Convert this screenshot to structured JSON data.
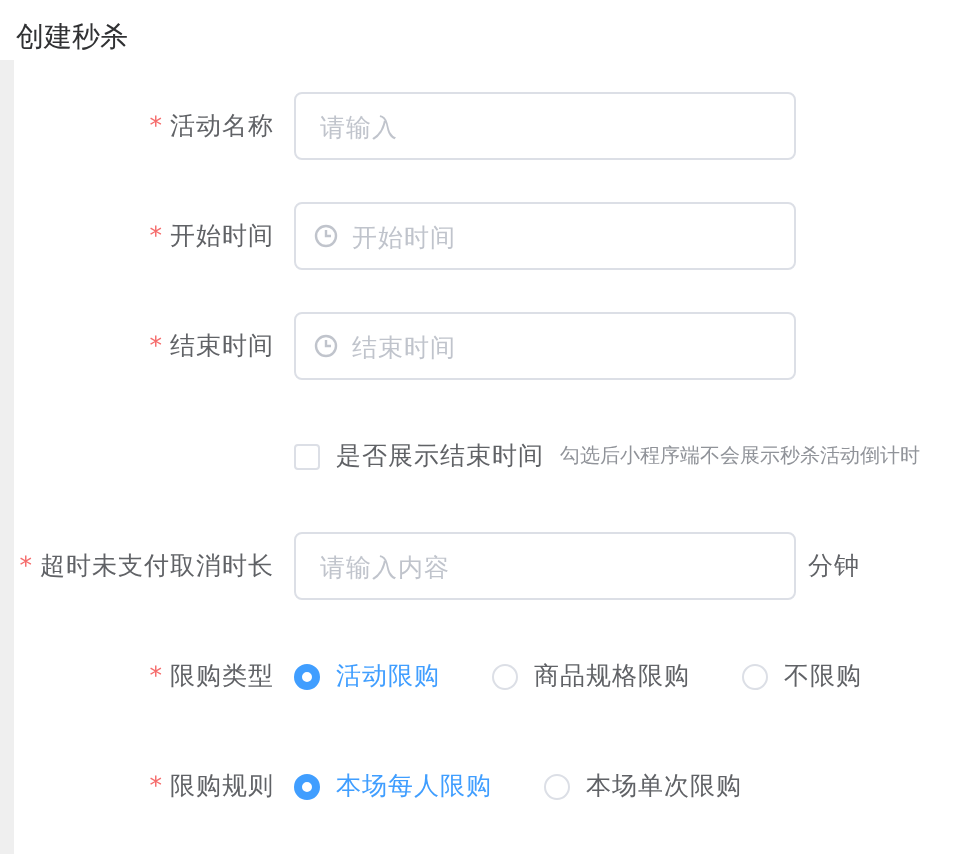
{
  "page_title": "创建秒杀",
  "form": [
    {
      "kind": "text",
      "label": "活动名称",
      "mark": "*",
      "placeholder": "请输入"
    },
    {
      "kind": "time",
      "label": "开始时间",
      "mark": "*",
      "placeholder": "开始时间"
    },
    {
      "kind": "time",
      "label": "结束时间",
      "mark": "*",
      "placeholder": "结束时间"
    },
    {
      "kind": "checkbox",
      "text": "是否展示结束时间",
      "checked": false,
      "hint": "勾选后小程序端不会展示秒杀活动倒计时"
    },
    {
      "kind": "text",
      "label": "超时未支付取消时长",
      "mark": "*",
      "placeholder": "请输入内容",
      "suffix": "分钟"
    },
    {
      "kind": "radio",
      "label": "限购类型",
      "mark": "*",
      "options": [
        {
          "label": "活动限购",
          "selected": true
        },
        {
          "label": "商品规格限购",
          "selected": false
        },
        {
          "label": "不限购",
          "selected": false
        }
      ]
    },
    {
      "kind": "radio",
      "label": "限购规则",
      "mark": "*",
      "options": [
        {
          "label": "本场每人限购",
          "selected": true
        },
        {
          "label": "本场单次限购",
          "selected": false
        }
      ]
    }
  ]
}
